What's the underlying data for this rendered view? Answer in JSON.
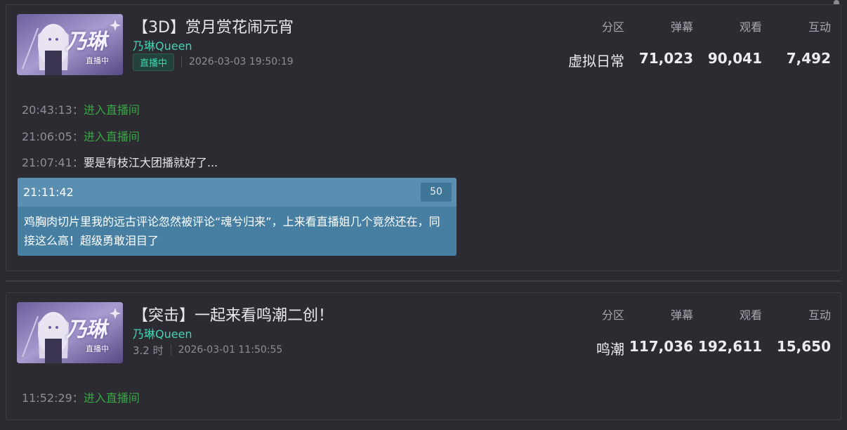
{
  "streams": [
    {
      "title": "【3D】赏月赏花闹元宵",
      "streamer": "乃琳Queen",
      "status_badge": "直播中",
      "start_time": "2026-03-03 19:50:19",
      "stats_headers": [
        "分区",
        "弹幕",
        "观看",
        "互动"
      ],
      "stats_values": [
        "虚拟日常",
        "71,023",
        "90,041",
        "7,492"
      ],
      "log": [
        {
          "time": "20:43:13",
          "text": "进入直播间",
          "type": "enter"
        },
        {
          "time": "21:06:05",
          "text": "进入直播间",
          "type": "enter"
        },
        {
          "time": "21:07:41",
          "text": "要是有枝江大团播就好了...",
          "type": "message"
        }
      ],
      "superchat": {
        "time": "21:11:42",
        "amount": "50",
        "message": "鸡胸肉切片里我的远古评论忽然被评论“魂兮归来”，上来看直播姐几个竟然还在，同接这么高！超级勇敢泪目了"
      }
    },
    {
      "title": "【突击】一起来看鸣潮二创！",
      "streamer": "乃琳Queen",
      "duration": "3.2 时",
      "start_time": "2026-03-01 11:50:55",
      "stats_headers": [
        "分区",
        "弹幕",
        "观看",
        "互动"
      ],
      "stats_values": [
        "鸣潮",
        "117,036",
        "192,611",
        "15,650"
      ],
      "log": [
        {
          "time": "11:52:29",
          "text": "进入直播间",
          "type": "enter"
        }
      ]
    }
  ],
  "thumbnail": {
    "logo_text": "乃琳",
    "logo_sub": "直播中"
  },
  "colors": {
    "accent_teal": "#3fd5b0",
    "enter_green": "#3aa646",
    "superchat_blue": "#467fa2"
  }
}
